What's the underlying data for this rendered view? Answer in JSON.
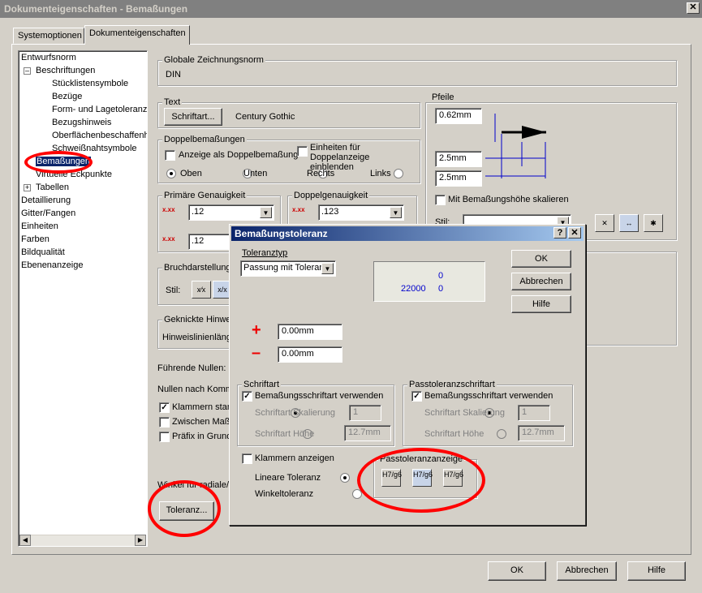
{
  "window": {
    "title": "Dokumenteigenschaften - Bemaßungen",
    "close": "✕"
  },
  "tabs": [
    "Systemoptionen",
    "Dokumenteigenschaften"
  ],
  "tree": {
    "items": [
      "Entwurfsnorm",
      "Beschriftungen",
      "Stücklistensymbole",
      "Bezüge",
      "Form- und Lagetoleranze",
      "Bezugshinweis",
      "Oberflächenbeschaffenh",
      "Schweißnahtsymbole",
      "Bemaßungen",
      "Virtuelle Eckpunkte",
      "Tabellen",
      "Detaillierung",
      "Gitter/Fangen",
      "Einheiten",
      "Farben",
      "Bildqualität",
      "Ebenenanzeige"
    ]
  },
  "norm": {
    "label": "Globale Zeichnungsnorm",
    "value": "DIN"
  },
  "text": {
    "label": "Text",
    "font_button": "Schriftart...",
    "font_value": "Century Gothic"
  },
  "double": {
    "label": "Doppelbemaßungen",
    "show_double": "Anzeige als Doppelbemaßung",
    "show_units": "Einheiten für Doppelanzeige einblenden",
    "positions": [
      "Oben",
      "Unten",
      "Rechts",
      "Links"
    ]
  },
  "primary": {
    "label": "Primäre Genauigkeit",
    "value1": ".12",
    "value2": ".12"
  },
  "dual": {
    "label": "Doppelgenauigkeit",
    "value1": ".123"
  },
  "break": {
    "label": "Bruchdarstellung",
    "style_label": "Stil:"
  },
  "leader": {
    "label": "Geknickte Hinwei",
    "length_label": "Hinweislinienläng"
  },
  "zeros": {
    "leading": "Führende Nullen:",
    "trailing": "Nullen nach Komma"
  },
  "checks": {
    "brackets": "Klammern stan",
    "between": "Zwischen Maßh",
    "prefix": "Präfix in Grund"
  },
  "angle_label": "Winkel für radiale/l",
  "tol_button": "Toleranz...",
  "arrows": {
    "label": "Pfeile",
    "v1": "0.62mm",
    "v2": "2.5mm",
    "v3": "2.5mm",
    "scale": "Mit Bemaßungshöhe skalieren",
    "style_label": "Stil:"
  },
  "footer": {
    "ok": "OK",
    "cancel": "Abbrechen",
    "help": "Hilfe"
  },
  "dialog": {
    "title": "Bemaßungstoleranz",
    "help_q": "?",
    "close": "✕",
    "toltype_label": "Toleranztyp",
    "toltype_value": "Passung mit Toleranz",
    "preview_top": "0",
    "preview_main": "22000",
    "preview_bot": "0",
    "plus": "+",
    "minus": "–",
    "plus_value": "0.00mm",
    "minus_value": "0.00mm",
    "ok": "OK",
    "cancel": "Abbrechen",
    "help": "Hilfe",
    "font": {
      "label": "Schriftart",
      "use_dim": "Bemaßungsschriftart verwenden",
      "scale": "Schriftart Skalierung",
      "scale_value": "1",
      "height": "Schriftart Höhe",
      "height_value": "12.7mm"
    },
    "fitfont": {
      "label": "Passtoleranzschriftart",
      "use_dim": "Bemaßungsschriftart verwenden",
      "scale": "Schriftart Skalierung",
      "scale_value": "1",
      "height": "Schriftart Höhe",
      "height_value": "12.7mm"
    },
    "brackets": "Klammern anzeigen",
    "linear": "Lineare Toleranz",
    "angular": "Winkeltoleranz",
    "fitdisplay": {
      "label": "Passtoleranzanzeige",
      "b1": "H7/g6",
      "b2": "H7/g6",
      "b3": "H7/g6"
    }
  },
  "colors": {
    "title_active": "#0a246a",
    "highlight_ring": "#ff0000",
    "preview_text": "#0000cc"
  }
}
